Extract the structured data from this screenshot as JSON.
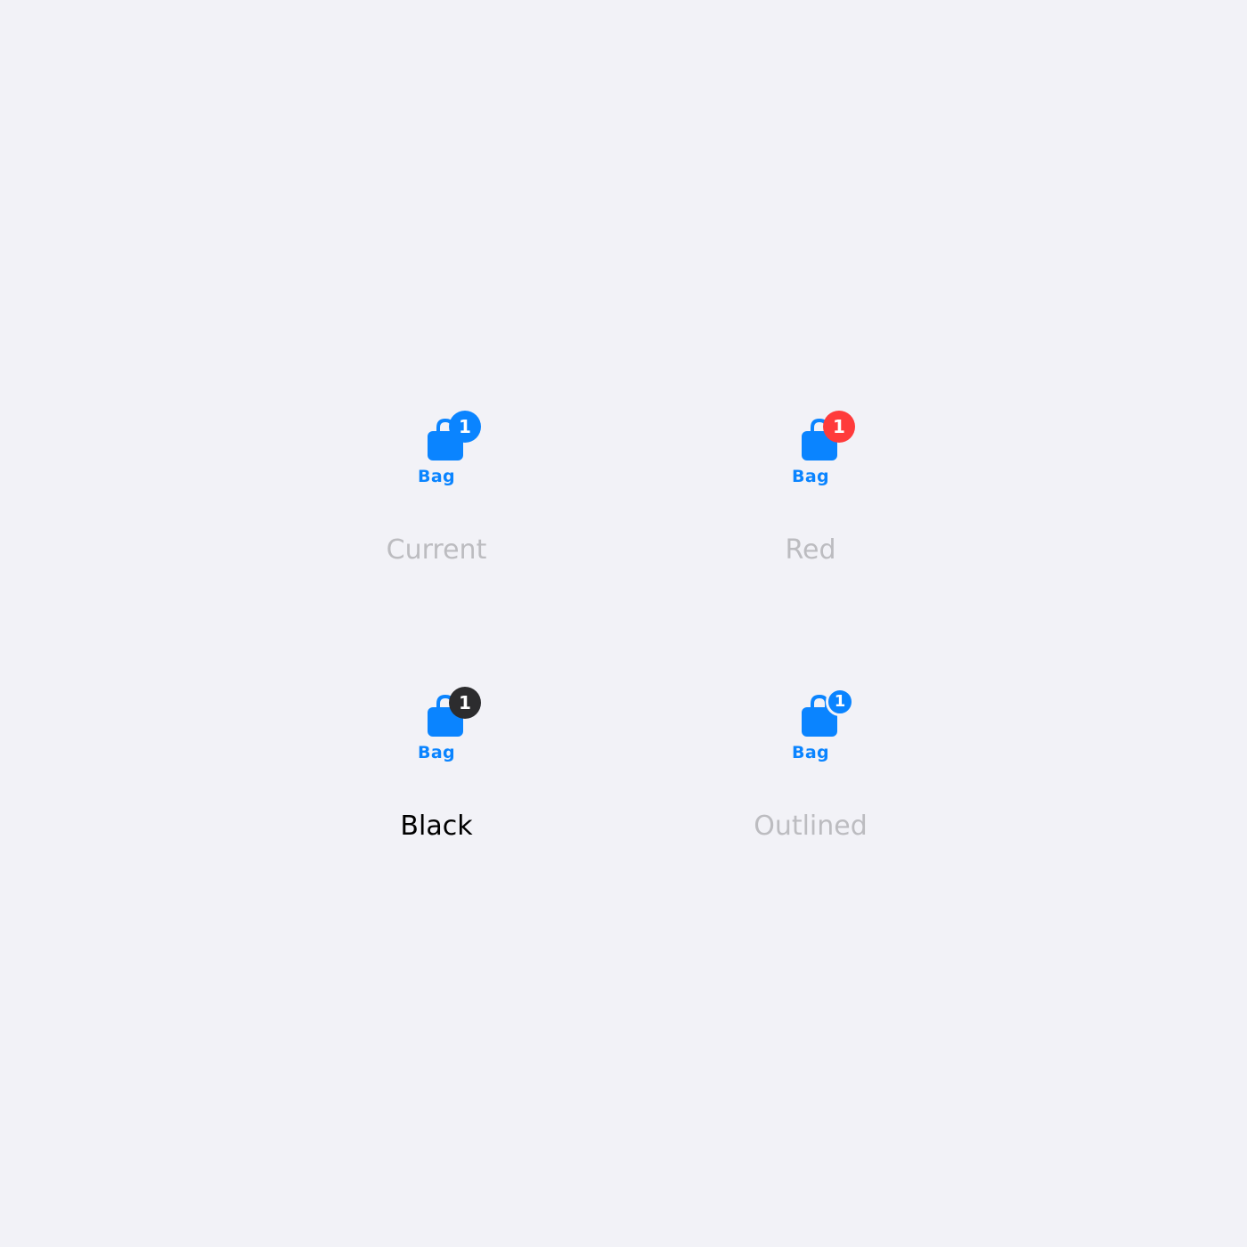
{
  "accent_color": "#0a84ff",
  "muted_label_color": "#bcbcc0",
  "selected_label_color": "#000000",
  "variants": [
    {
      "tab_label": "Bag",
      "icon": "shopping-bag-icon",
      "badge_count": "1",
      "badge_color": "#0a84ff",
      "badge_style": "filled",
      "option_label": "Current",
      "selected": false
    },
    {
      "tab_label": "Bag",
      "icon": "shopping-bag-icon",
      "badge_count": "1",
      "badge_color": "#ff3b3b",
      "badge_style": "filled",
      "option_label": "Red",
      "selected": false
    },
    {
      "tab_label": "Bag",
      "icon": "shopping-bag-icon",
      "badge_count": "1",
      "badge_color": "#2c2c2e",
      "badge_style": "filled",
      "option_label": "Black",
      "selected": true
    },
    {
      "tab_label": "Bag",
      "icon": "shopping-bag-icon",
      "badge_count": "1",
      "badge_color": "#0a84ff",
      "badge_style": "outlined",
      "option_label": "Outlined",
      "selected": false
    }
  ]
}
